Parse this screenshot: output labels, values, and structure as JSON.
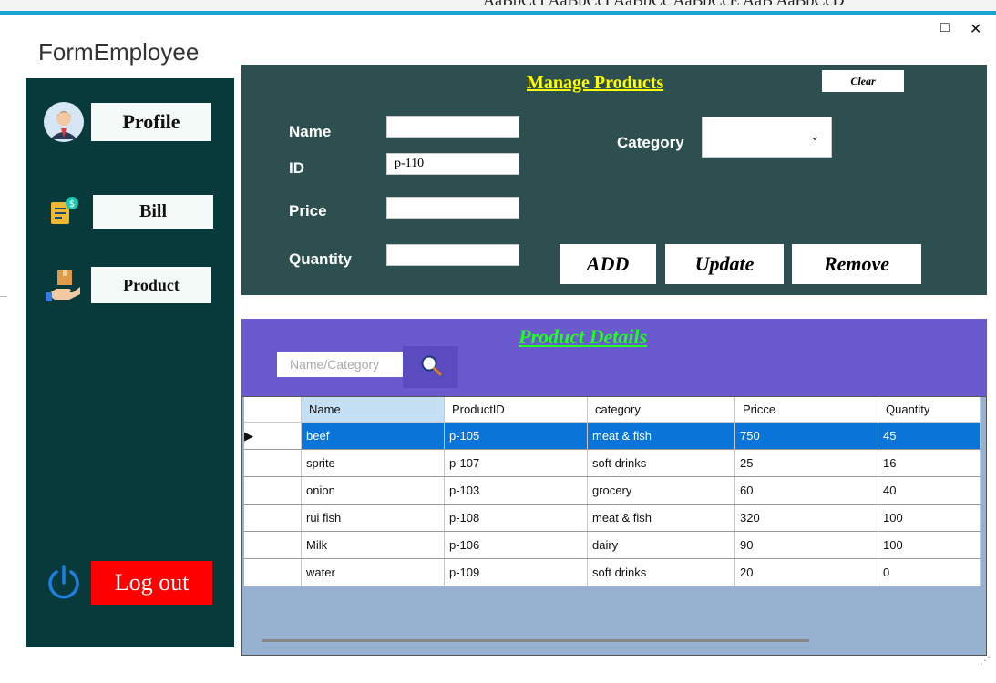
{
  "window": {
    "title": "FormEmployee",
    "maximize_glyph": "□",
    "close_glyph": "✕"
  },
  "background_strip": {
    "text": "AaBbCcI AaBbCcI AaBbCc AaBbCcE AaB AaBbCcD"
  },
  "sidebar": {
    "items": [
      {
        "label": "Profile",
        "icon": "user-avatar-icon"
      },
      {
        "label": "Bill",
        "icon": "bill-icon"
      },
      {
        "label": "Product",
        "icon": "product-hand-icon"
      }
    ],
    "logout_label": "Log out",
    "logout_icon": "power-icon"
  },
  "manage": {
    "title": "Manage Products",
    "clear_label": "Clear",
    "fields": {
      "name_label": "Name",
      "id_label": "ID",
      "price_label": "Price",
      "quantity_label": "Quantity",
      "category_label": "Category",
      "name_value": "",
      "id_value": "p-110",
      "price_value": "",
      "quantity_value": "",
      "category_value": ""
    },
    "buttons": {
      "add": "ADD",
      "update": "Update",
      "remove": "Remove"
    }
  },
  "details": {
    "title": "Product Details",
    "search_placeholder": "Name/Category",
    "search_icon": "search-icon"
  },
  "grid": {
    "columns": [
      "Name",
      "ProductID",
      "category",
      "Pricce",
      "Quantity"
    ],
    "rows": [
      {
        "name": "beef",
        "id": "p-105",
        "category": "meat & fish",
        "price": "750",
        "quantity": "45"
      },
      {
        "name": "sprite",
        "id": "p-107",
        "category": "soft drinks",
        "price": "25",
        "quantity": "16"
      },
      {
        "name": "onion",
        "id": "p-103",
        "category": "grocery",
        "price": "60",
        "quantity": "40"
      },
      {
        "name": "rui fish",
        "id": "p-108",
        "category": "meat & fish",
        "price": "320",
        "quantity": "100"
      },
      {
        "name": "Milk",
        "id": "p-106",
        "category": "dairy",
        "price": "90",
        "quantity": "100"
      },
      {
        "name": "water",
        "id": "p-109",
        "category": "soft drinks",
        "price": "20",
        "quantity": "0"
      }
    ],
    "selected_row_marker": "▶"
  },
  "colors": {
    "sidebar": "#083a3c",
    "manage_panel": "#2d4f4f",
    "details_panel": "#6a5acd",
    "logout": "#ff0000",
    "title_yellow": "#ffff00",
    "title_green": "#20ff20",
    "selected_row": "#0a74d8"
  }
}
